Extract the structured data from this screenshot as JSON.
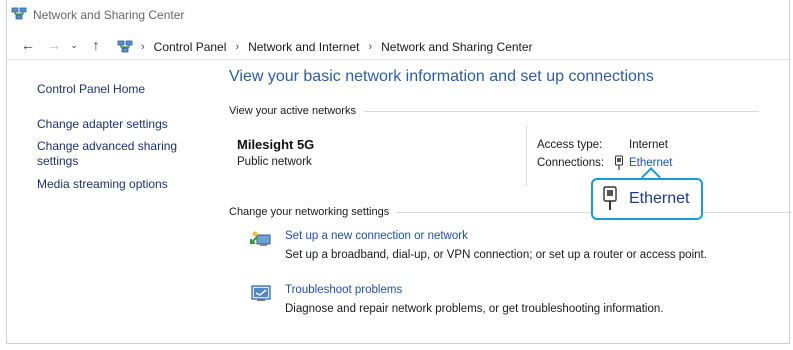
{
  "window": {
    "title": "Network and Sharing Center"
  },
  "address_bar": {
    "crumbs": [
      "Control Panel",
      "Network and Internet",
      "Network and Sharing Center"
    ]
  },
  "sidebar": {
    "items": [
      {
        "label": "Control Panel Home"
      },
      {
        "label": "Change adapter settings"
      },
      {
        "label": "Change advanced sharing settings"
      },
      {
        "label": "Media streaming options"
      }
    ]
  },
  "main": {
    "heading": "View your basic network information and set up connections",
    "active_networks_label": "View your active networks",
    "network": {
      "name": "Milesight 5G",
      "type": "Public network",
      "access_type_label": "Access type:",
      "access_type_value": "Internet",
      "connections_label": "Connections:",
      "connections_value": "Ethernet"
    },
    "callout": {
      "label": "Ethernet"
    },
    "change_settings_label": "Change your networking settings",
    "tasks": [
      {
        "icon": "new-connection-icon",
        "link": "Set up a new connection or network",
        "desc": "Set up a broadband, dial-up, or VPN connection; or set up a router or access point."
      },
      {
        "icon": "troubleshoot-icon",
        "link": "Troubleshoot problems",
        "desc": "Diagnose and repair network problems, or get troubleshooting information."
      }
    ]
  },
  "colors": {
    "heading": "#2c5ba6",
    "link": "#1f4fb0",
    "callout_border": "#1a9ad6"
  }
}
